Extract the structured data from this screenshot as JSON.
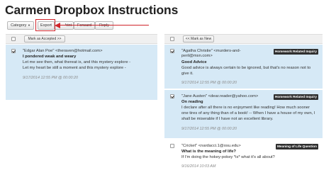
{
  "title": "Carmen Dropbox Instructions",
  "toolbar": {
    "category_label": "Category",
    "export_label": "Export",
    "print_label": "Print",
    "forward_label": "Forward",
    "reply_label": "Reply"
  },
  "left_panel": {
    "header_button": "Mark as Accepted >>",
    "messages": [
      {
        "checked": true,
        "selected": true,
        "from": "\"Edgar Alan Poe\" <theraven@hotmail.com>",
        "subject": "I pondered weak and weary",
        "body": [
          "Let me see then, what thereat is, and this mystery explore -",
          "Let my heart be still a moment and this mystery explore -"
        ],
        "time": "9/17/2014 12:55 PM @ 00:00:20"
      }
    ]
  },
  "right_panel": {
    "header_button": "<< Mark as New",
    "messages": [
      {
        "checked": true,
        "selected": true,
        "from": [
          "\"Agatha Christie\" <murders-and-",
          "peril@msn.com>"
        ],
        "badge": "Homework Related Inquiry",
        "subject": "Good Advice",
        "body": [
          "Good advice is always certain to be ignored, but that's no reason not to",
          "give it."
        ],
        "time": "9/17/2014 12:55 PM @ 00:00:20"
      },
      {
        "checked": true,
        "selected": true,
        "from": "\"Jane Austen\" <dear.reader@yahoo.com>",
        "badge": "Homework Related Inquiry",
        "subject": "On reading",
        "body": [
          "I declare after all there is no enjoyment like reading! How much sooner",
          "one tires of any thing than of a book! -- When I have a house of my own, I",
          "shall be miserable if I have not an excellent library."
        ],
        "time": "9/17/2014 12:55 PM @ 00:00:20"
      },
      {
        "checked": false,
        "selected": false,
        "from": "\"Cricket\" <nardacci.1@osu.edu>",
        "badge": "Meaning of Life Question",
        "subject": "What is the meaning of life?",
        "body": [
          "If I'm doing the hokey-pokey *is* what it's all about?"
        ],
        "time": "9/16/2014 10:03 AM"
      }
    ]
  },
  "colors": {
    "selected_row": "#d6e9f6",
    "highlight": "#d0242a",
    "badge_bg": "#2f2f2f"
  }
}
